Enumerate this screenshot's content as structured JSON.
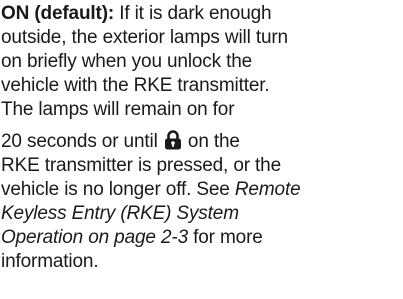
{
  "paragraph": {
    "heading": "ON (default):",
    "line1_rest": " If it is dark enough",
    "line2": "outside, the exterior lamps will turn",
    "line3": "on briefly when you unlock the",
    "line4": "vehicle with the RKE transmitter.",
    "line5": "The lamps will remain on for",
    "line6_before_icon": "20 seconds or until ",
    "line6_icon": "lock-icon",
    "line6_after_icon": " on the",
    "line7": "RKE transmitter is pressed, or the",
    "line8_plain": "vehicle is no longer off. See ",
    "line8_ref": "Remote",
    "line9_ref": "Keyless Entry (RKE) System",
    "line10_ref": "Operation on page 2-3",
    "line10_rest": " for more",
    "line11": "information."
  }
}
